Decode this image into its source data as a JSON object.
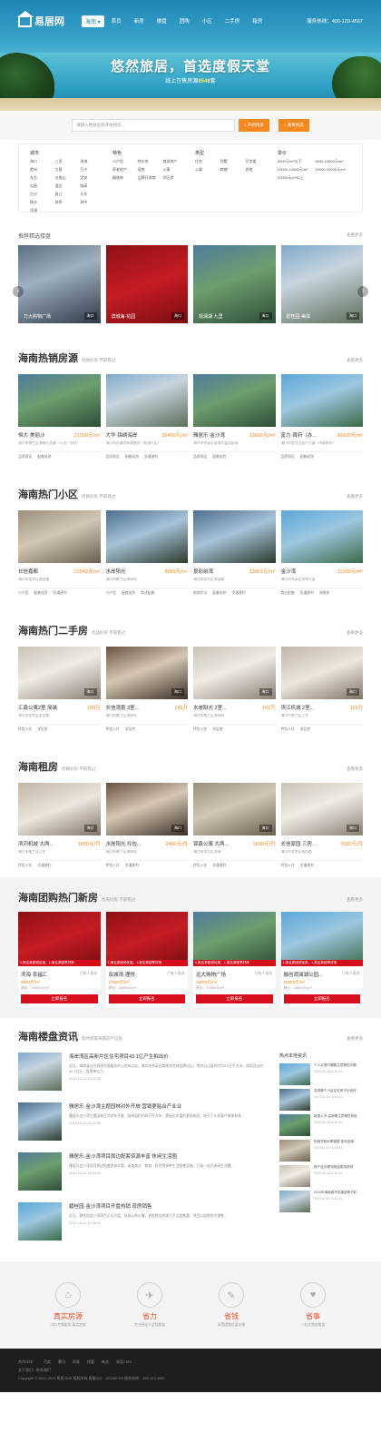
{
  "header": {
    "logo": "易居网",
    "city": "海南",
    "nav": [
      "首页",
      "新房",
      "楼盘",
      "团购",
      "小区",
      "二手房",
      "租房"
    ],
    "hotline": "服务热线：400-120-4567"
  },
  "hero": {
    "slogan": "悠然旅居，首选度假天堂",
    "sub_prefix": "线上在售房源",
    "sub_count": "8548",
    "sub_suffix": "套"
  },
  "search": {
    "placeholder": "请输入楼盘名称开始找房...",
    "btn": "开始找房",
    "btn2": "我要找房"
  },
  "filter": [
    {
      "title": "城市",
      "items": [
        "海口",
        "三亚",
        "琼海",
        "儋州",
        "文昌",
        "万宁",
        "东方",
        "五指山",
        "定安",
        "屯昌",
        "澄迈",
        "临高",
        "白沙",
        "昌江",
        "乐东",
        "陵水",
        "保亭",
        "琼中",
        "洋浦"
      ]
    },
    {
      "title": "特色",
      "items": [
        "小户型",
        "特价房",
        "旅游地产",
        "养老地产",
        "现房",
        "公寓",
        "精装修",
        "品牌开发商",
        "学区房"
      ]
    },
    {
      "title": "类型",
      "items": [
        "住宅",
        "别墅",
        "写字楼",
        "公寓",
        "商铺",
        "其他"
      ]
    },
    {
      "title": "单价",
      "items": [
        "8000元/m²以下",
        "8000-10000元/m²",
        "10000-15000元/m²",
        "15000-20000元/m²",
        "20000元/m²以上"
      ]
    }
  ],
  "recommend": {
    "title": "推荐精选楼盘",
    "more": "查看更多",
    "items": [
      {
        "name": "万大购物广场",
        "tag": "海口"
      },
      {
        "name": "滨城海·花园",
        "tag": "海口"
      },
      {
        "name": "观澜湖·九里",
        "tag": "海口"
      },
      {
        "name": "碧桂园·美岸",
        "tag": "海口"
      }
    ]
  },
  "sections": [
    {
      "title": "海南热销房源",
      "sub": "优质好房 不容错过",
      "more": "查看更多",
      "items": [
        {
          "name": "恒大·美丽沙",
          "price": "21500元/m²",
          "addr": "海口市美兰区海甸五西路（万达广场旁）",
          "tags": [
            "品质保证",
            "配套成熟"
          ]
        },
        {
          "name": "大华·锦绣海岸",
          "price": "35400元/m²",
          "addr": "海口市西海岸新海港旁（长流片区）",
          "tags": [
            "品质保证",
            "配套成熟",
            "交通便利"
          ]
        },
        {
          "name": "雅居乐·金沙湾",
          "price": "13800元/m²",
          "addr": "海口市秀英区滨海大道西延线",
          "tags": [
            "品质保证",
            "配套成熟"
          ]
        },
        {
          "name": "富力·首府（办...",
          "price": "30000元/m²",
          "addr": "海口市龙华区国兴大道（市政府旁）",
          "tags": [
            "品质保证",
            "配套成熟"
          ]
        }
      ]
    },
    {
      "title": "海南热门小区",
      "sub": "优质好房 不容错过",
      "more": "查看更多",
      "items": [
        {
          "name": "长信嘉都",
          "price": "22042元/m²",
          "addr": "海口市龙华区城西路",
          "tags": [
            "小户型",
            "配套成熟",
            "交通便利"
          ]
        },
        {
          "name": "水岸阳光",
          "price": "8999元/m²",
          "addr": "海口市美兰区海甸岛",
          "tags": [
            "小户型",
            "配套成熟",
            "商业配套"
          ]
        },
        {
          "name": "景彩前湾",
          "price": "13861元/m²",
          "addr": "海口市龙华区滨涯路",
          "tags": [
            "南湖学位",
            "配套成熟",
            "交通便利"
          ]
        },
        {
          "name": "金沙湾",
          "price": "11000元/m²",
          "addr": "海口市秀英区滨海大道",
          "tags": [
            "商业配套",
            "交通便利",
            "海景房"
          ]
        }
      ]
    },
    {
      "title": "海南热门二手房",
      "sub": "优品好房 不容错过",
      "more": "查看更多",
      "items": [
        {
          "name": "汇鑫公寓2室 简装",
          "price": "109万",
          "addr": "海口市龙华区金龙路",
          "tags": [
            "拎包入住",
            "学区房"
          ]
        },
        {
          "name": "长信湾景 3室...",
          "price": "145万",
          "addr": "海口市美兰区海甸岛",
          "tags": [
            "拎包入住",
            "学区房"
          ]
        },
        {
          "name": "水岸阳光 2室...",
          "price": "101万",
          "addr": "海口市美兰区海甸岛",
          "tags": [
            "拎包入住",
            "学区房"
          ]
        },
        {
          "name": "滨江机城 2室...",
          "price": "116万",
          "addr": "海口市美兰区江东",
          "tags": [
            "拎包入住",
            "学区房"
          ]
        }
      ]
    },
    {
      "title": "海南租房",
      "sub": "优质好房 不容错过",
      "more": "查看更多",
      "items": [
        {
          "name": "滨河机城 大两...",
          "price": "1800元/月",
          "addr": "海口市美兰区江东",
          "tags": [
            "拎包入住",
            "交通便利"
          ]
        },
        {
          "name": "水岸阳光 拎包...",
          "price": "2400元/月",
          "addr": "海口市美兰区海甸岛",
          "tags": [
            "拎包入住",
            "交通便利"
          ]
        },
        {
          "name": "锦鑫公寓 大两...",
          "price": "2600元/月",
          "addr": "海口市龙华区滨海",
          "tags": [
            "拎包入住",
            "交通便利"
          ]
        },
        {
          "name": "长信家园 三房...",
          "price": "3500元/月",
          "addr": "海口市龙华区城西路",
          "tags": [
            "拎包入住",
            "交通便利"
          ]
        }
      ]
    }
  ],
  "group": {
    "title": "海南团购热门新房",
    "sub": "优先好房 不容错过",
    "more": "查看更多",
    "banner": "1.报名参团领优惠，1.报名参团享好房",
    "btn": "立即报名",
    "items": [
      {
        "name": "滨海·幸福汇",
        "count": "已有人报名",
        "price": "9800元/m²",
        "price2": "原价：10500元/m²"
      },
      {
        "name": "双城湾·理悦",
        "count": "已有人报名",
        "price": "17800元/m²",
        "price2": "原价：18000元/m²"
      },
      {
        "name": "远大购物广场",
        "count": "已有人报名",
        "price": "16800元/m²",
        "price2": "原价：17500元/m²"
      },
      {
        "name": "融创观澜湖公园...",
        "count": "已有人报名",
        "price": "15800元/m²",
        "price2": "原价：16800元/m²"
      }
    ]
  },
  "news": {
    "title": "海南楼盘资讯",
    "sub": "及时获取海南房产信息",
    "more": "查看更多",
    "items": [
      {
        "title": "海岸湾区高新片区住宅项目43.1亿产生拍出价",
        "desc": "近日，海南省公共资源交易服务中心发布公告，海口市秀英区某地块完成挂牌出让，地块出让面积约为2.3万平方米，成交总价约43.1亿元，竞得单位为...",
        "date": "2019-10-11 14:22:45"
      },
      {
        "title": "雅居乐·金沙湾主题园林对外开放 营销更贴合产业业",
        "desc": "雅居乐金沙湾主题园林正式对外开放，园林面积约两万平方米，营造出丰富的景观体验，吸引了众多客户前来参观...",
        "date": "2019-10-11 14:22:59"
      },
      {
        "title": "雅居乐·金沙湾项目周边配套资源丰富 休闲生活圈",
        "desc": "雅居乐金沙湾项目周边配套资源丰富，涵盖商业、教育、医疗等多种生活配套设施，打造一站式休闲生活圈...",
        "date": "2019-10-11 14:16:04"
      },
      {
        "title": "碧桂园·金沙湾项目开盘热销 现房销售",
        "desc": "近日，碧桂园金沙湾项目正式开盘，现场认购火爆，首批推出房源几乎全部售罄，项目以现房形式销售...",
        "date": "2019-10-11 14:16:04"
      }
    ],
    "hot_title": "热点本地资讯",
    "hot": [
      {
        "title": "个人买房时需要注意哪些问题",
        "date": "2019-10-11 11:40:43"
      },
      {
        "title": "选择哪个小区住宅房子比较好",
        "date": "2019-10-11 11:40:43"
      },
      {
        "title": "新盘入市 买房需注意哪些风险",
        "date": "2019-10-11 11:40:43"
      },
      {
        "title": "购房贷款利率调整 如何选择",
        "date": "2019-10-11 11:40:43"
      },
      {
        "title": "房产证办理流程及费用说明",
        "date": "2019-10-11 11:40:43"
      },
      {
        "title": "2019年海南楼市发展趋势分析",
        "date": "2019-10-11 11:40:43"
      }
    ]
  },
  "features": [
    {
      "t": "真实房源",
      "s": "1对1专属服务 真实房源"
    },
    {
      "t": "省力",
      "s": "专业经纪人全程服务"
    },
    {
      "t": "省钱",
      "s": "享受团购优惠价格"
    },
    {
      "t": "省事",
      "s": "一站式购房服务"
    }
  ],
  "footer": {
    "links": [
      "合作伙伴：",
      "百度",
      "腾讯",
      "网易",
      "搜狐",
      "新浪",
      "易居CMS"
    ],
    "about": "关于我们：联系我们",
    "copy": "Copyright © 2012-2019 易居CMS 版权所有  客服QQ：123456789  服务热线：400-123-4567"
  }
}
